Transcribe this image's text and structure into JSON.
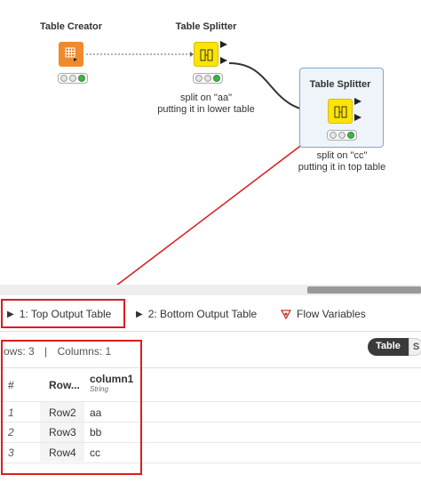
{
  "nodes": {
    "creator": {
      "title": "Table Creator"
    },
    "splitter1": {
      "title": "Table Splitter",
      "annotation": [
        "split on \"aa\"",
        "putting it in lower table"
      ]
    },
    "splitter2": {
      "title": "Table Splitter",
      "annotation": [
        "split on \"cc\"",
        "putting it in top table"
      ]
    }
  },
  "tabs": [
    {
      "label": "1: Top Output Table"
    },
    {
      "label": "2: Bottom Output Table"
    },
    {
      "label": "Flow Variables"
    }
  ],
  "stats": {
    "rows": "ows: 3",
    "sep": "|",
    "columns": "Columns: 1"
  },
  "view_toggle": {
    "active": "Table",
    "other": "S"
  },
  "table": {
    "headers": {
      "index": "#",
      "rowid": "Row...",
      "column": "column1",
      "column_type": "String"
    },
    "rows": [
      {
        "num": "1",
        "id": "Row2",
        "value": "aa"
      },
      {
        "num": "2",
        "id": "Row3",
        "value": "bb"
      },
      {
        "num": "3",
        "id": "Row4",
        "value": "cc"
      }
    ]
  },
  "colors": {
    "accent_red": "#d81e1e",
    "node_orange": "#f08a2c",
    "node_yellow": "#ffe400",
    "status_green": "#3db34a"
  }
}
